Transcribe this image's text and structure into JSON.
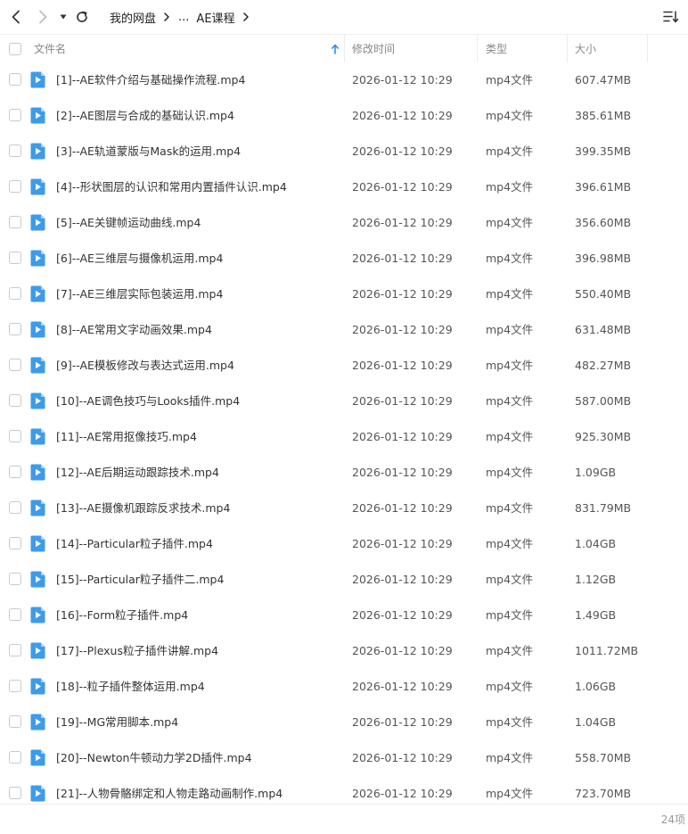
{
  "toolbar": {
    "back_icon": "chevron-left-icon",
    "forward_icon": "chevron-right-icon",
    "history_icon": "caret-down-icon",
    "refresh_icon": "refresh-icon",
    "sort_icon": "sort-list-icon",
    "breadcrumb": [
      "我的网盘",
      "...",
      "AE课程"
    ]
  },
  "header": {
    "name": "文件名",
    "modified": "修改时间",
    "type": "类型",
    "size": "大小"
  },
  "colors": {
    "file_icon": "#3d9bea",
    "accent": "#2b8fee"
  },
  "files": [
    {
      "name": "[1]--AE软件介绍与基础操作流程.mp4",
      "time": "2026-01-12 10:29",
      "type": "mp4文件",
      "size": "607.47MB"
    },
    {
      "name": "[2]--AE图层与合成的基础认识.mp4",
      "time": "2026-01-12 10:29",
      "type": "mp4文件",
      "size": "385.61MB"
    },
    {
      "name": "[3]--AE轨道蒙版与Mask的运用.mp4",
      "time": "2026-01-12 10:29",
      "type": "mp4文件",
      "size": "399.35MB"
    },
    {
      "name": "[4]--形状图层的认识和常用内置插件认识.mp4",
      "time": "2026-01-12 10:29",
      "type": "mp4文件",
      "size": "396.61MB"
    },
    {
      "name": "[5]--AE关键帧运动曲线.mp4",
      "time": "2026-01-12 10:29",
      "type": "mp4文件",
      "size": "356.60MB"
    },
    {
      "name": "[6]--AE三维层与摄像机运用.mp4",
      "time": "2026-01-12 10:29",
      "type": "mp4文件",
      "size": "396.98MB"
    },
    {
      "name": "[7]--AE三维层实际包装运用.mp4",
      "time": "2026-01-12 10:29",
      "type": "mp4文件",
      "size": "550.40MB"
    },
    {
      "name": "[8]--AE常用文字动画效果.mp4",
      "time": "2026-01-12 10:29",
      "type": "mp4文件",
      "size": "631.48MB"
    },
    {
      "name": "[9]--AE模板修改与表达式运用.mp4",
      "time": "2026-01-12 10:29",
      "type": "mp4文件",
      "size": "482.27MB"
    },
    {
      "name": "[10]--AE调色技巧与Looks插件.mp4",
      "time": "2026-01-12 10:29",
      "type": "mp4文件",
      "size": "587.00MB"
    },
    {
      "name": "[11]--AE常用抠像技巧.mp4",
      "time": "2026-01-12 10:29",
      "type": "mp4文件",
      "size": "925.30MB"
    },
    {
      "name": "[12]--AE后期运动跟踪技术.mp4",
      "time": "2026-01-12 10:29",
      "type": "mp4文件",
      "size": "1.09GB"
    },
    {
      "name": "[13]--AE摄像机跟踪反求技术.mp4",
      "time": "2026-01-12 10:29",
      "type": "mp4文件",
      "size": "831.79MB"
    },
    {
      "name": "[14]--Particular粒子插件.mp4",
      "time": "2026-01-12 10:29",
      "type": "mp4文件",
      "size": "1.04GB"
    },
    {
      "name": "[15]--Particular粒子插件二.mp4",
      "time": "2026-01-12 10:29",
      "type": "mp4文件",
      "size": "1.12GB"
    },
    {
      "name": "[16]--Form粒子插件.mp4",
      "time": "2026-01-12 10:29",
      "type": "mp4文件",
      "size": "1.49GB"
    },
    {
      "name": "[17]--Plexus粒子插件讲解.mp4",
      "time": "2026-01-12 10:29",
      "type": "mp4文件",
      "size": "1011.72MB"
    },
    {
      "name": "[18]--粒子插件整体运用.mp4",
      "time": "2026-01-12 10:29",
      "type": "mp4文件",
      "size": "1.06GB"
    },
    {
      "name": "[19]--MG常用脚本.mp4",
      "time": "2026-01-12 10:29",
      "type": "mp4文件",
      "size": "1.04GB"
    },
    {
      "name": "[20]--Newton牛顿动力学2D插件.mp4",
      "time": "2026-01-12 10:29",
      "type": "mp4文件",
      "size": "558.70MB"
    },
    {
      "name": "[21]--人物骨骼绑定和人物走路动画制作.mp4",
      "time": "2026-01-12 10:29",
      "type": "mp4文件",
      "size": "723.70MB"
    }
  ],
  "footer": {
    "count": "24项"
  }
}
